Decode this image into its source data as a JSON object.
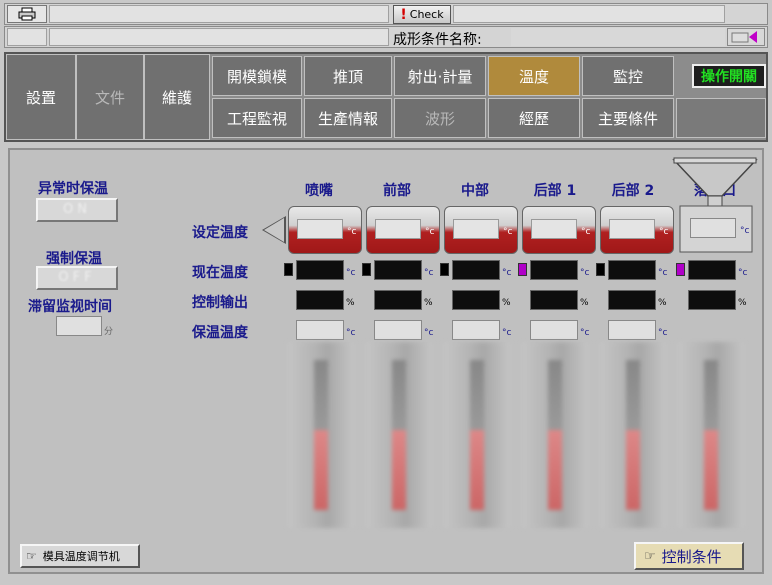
{
  "header": {
    "check_label": "Check",
    "condition_name_label": "成形条件名称:",
    "condition_name_value": ""
  },
  "nav": {
    "row1": [
      "開模鎖模",
      "推頂",
      "射出·計量",
      "溫度",
      "監控"
    ],
    "row2": [
      "工程監視",
      "生產情報",
      "波形",
      "經歷",
      "主要條件"
    ],
    "left": [
      "設置",
      "文件",
      "維護"
    ],
    "active": "溫度",
    "operation_switch": "操作開關"
  },
  "left_panel": {
    "abnormal_hold_label": "异常时保温",
    "abnormal_hold_value": "ON",
    "forced_hold_label": "强制保温",
    "forced_hold_value": "OFF",
    "dwell_monitor_label": "滞留监视时间",
    "dwell_unit": "分"
  },
  "rows": {
    "set_temp": "设定温度",
    "current_temp": "现在温度",
    "control_output": "控制输出",
    "hold_temp": "保温温度"
  },
  "zones": [
    "喷嘴",
    "前部",
    "中部",
    "后部 1",
    "后部 2",
    "落下口"
  ],
  "units": {
    "temp": "°c",
    "percent": "%"
  },
  "indicator_colors": [
    "#000000",
    "#000000",
    "#000000",
    "#b000c8",
    "#000000",
    "#b000c8"
  ],
  "footer": {
    "mold_temp_button": "模具温度调节机",
    "control_cond_button": "控制条件"
  },
  "colors": {
    "active_tab": "#b08a3c",
    "barrel_red": "#a01818",
    "label_blue": "#1a1a8c",
    "switch_green": "#22e022"
  }
}
